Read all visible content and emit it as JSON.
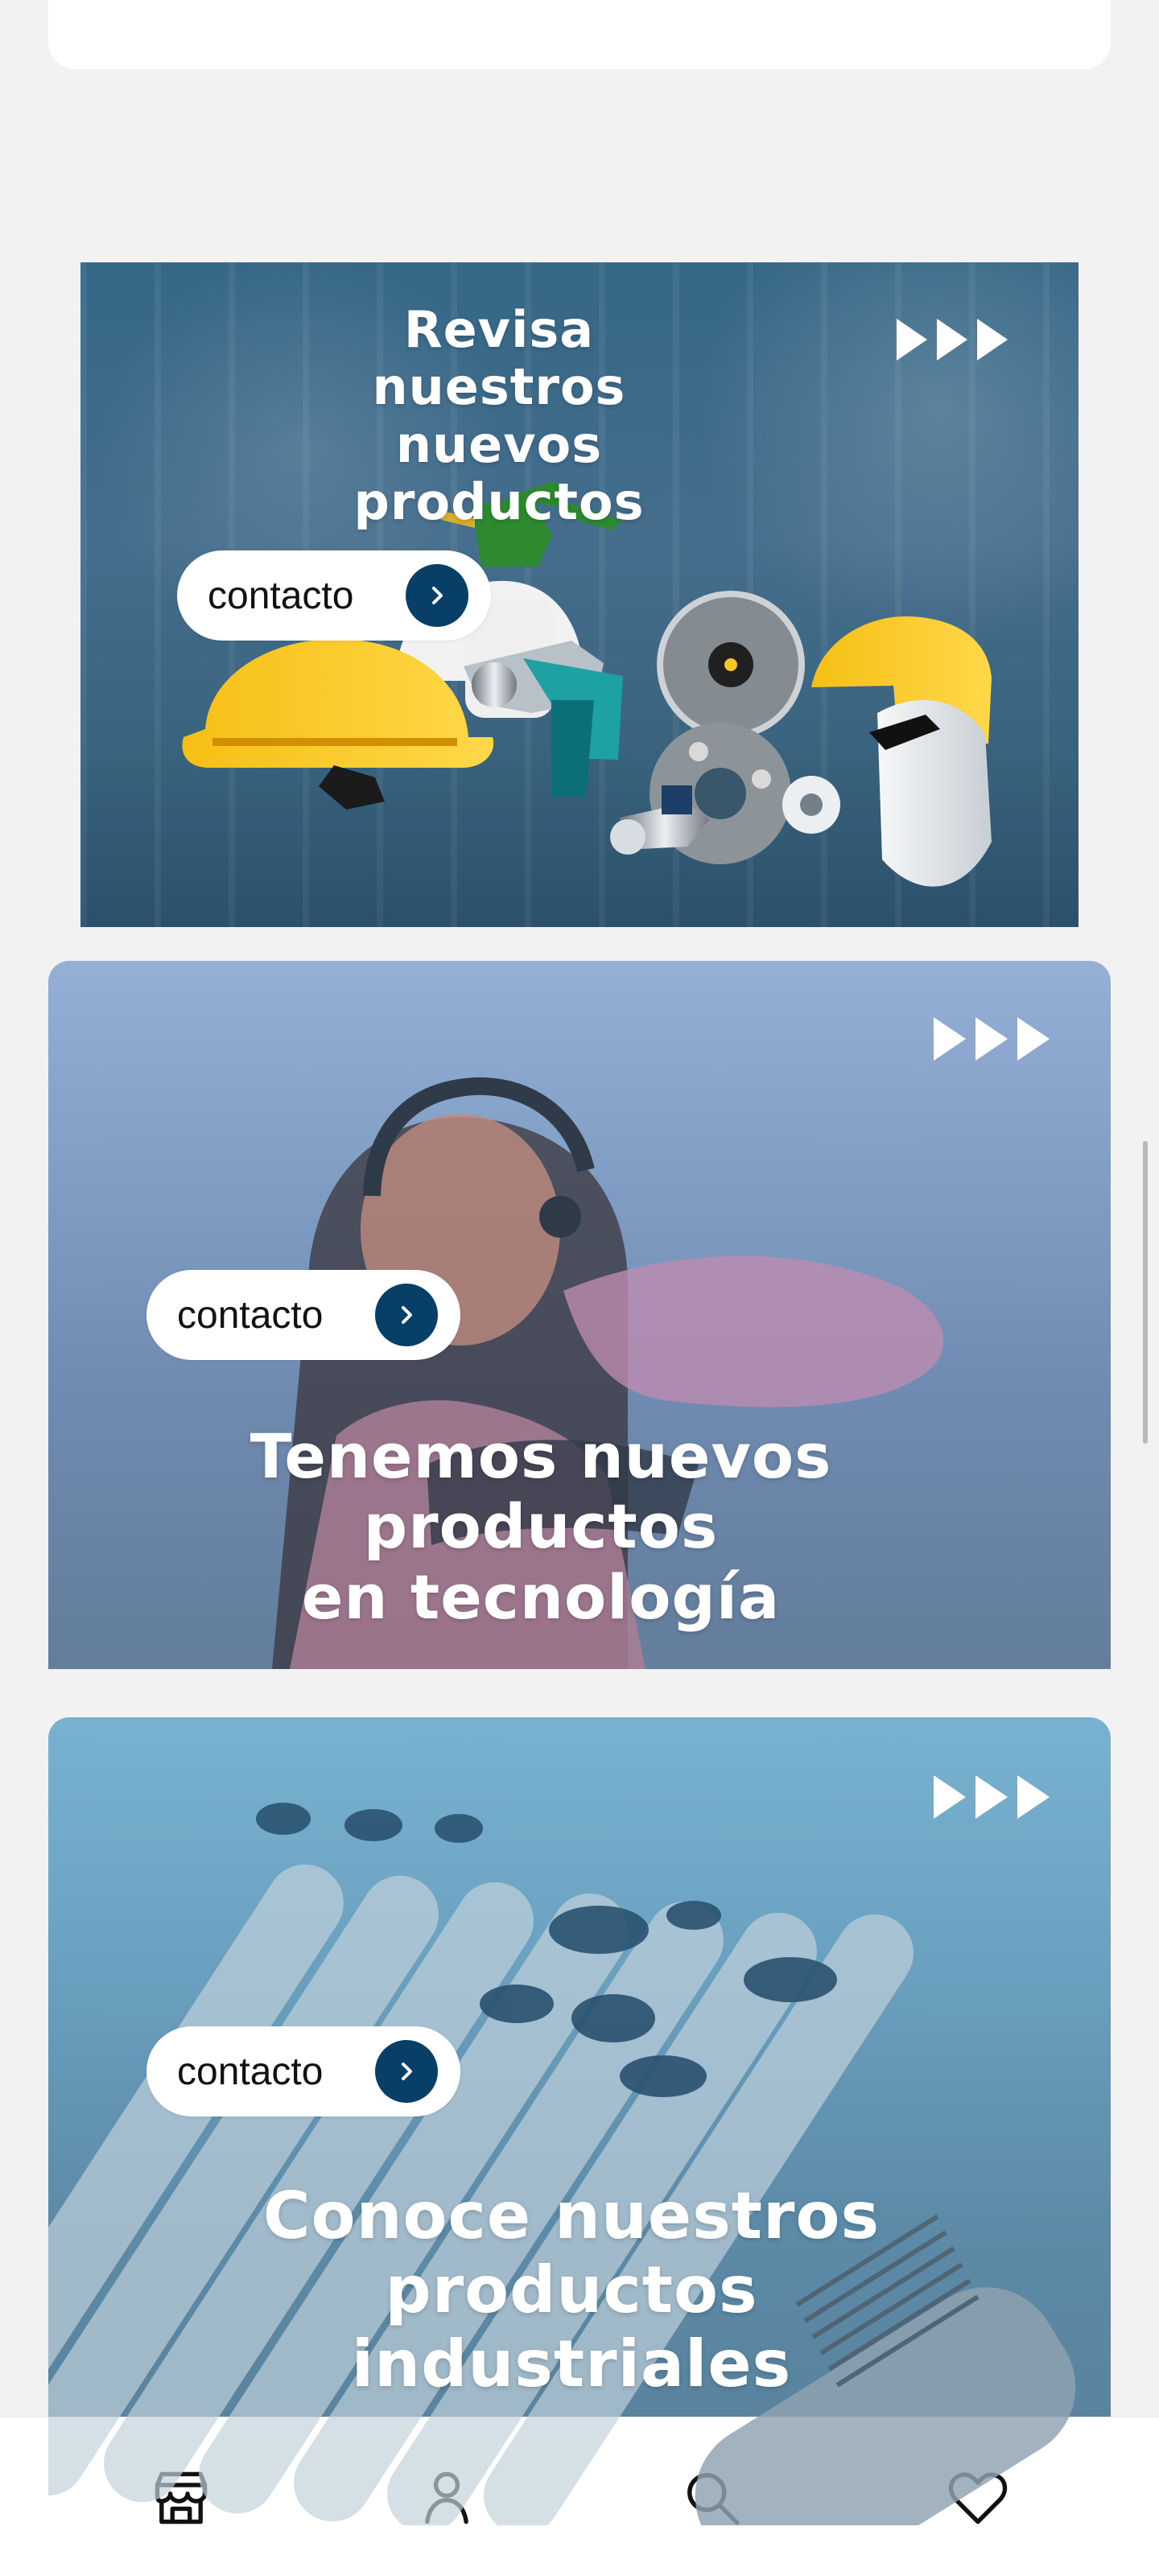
{
  "banners": [
    {
      "title_line1": "Revisa nuestros",
      "title_line2": "nuevos productos",
      "button_label": "contacto"
    },
    {
      "title_line1": "Tenemos nuevos productos",
      "title_line2": "en tecnología",
      "button_label": "contacto"
    },
    {
      "title_line1": "Conoce nuestros",
      "title_line2": "productos industriales",
      "button_label": "contacto"
    }
  ],
  "bottom_nav": {
    "items": [
      {
        "icon": "store-icon"
      },
      {
        "icon": "user-icon"
      },
      {
        "icon": "search-icon"
      },
      {
        "icon": "heart-icon"
      }
    ]
  }
}
